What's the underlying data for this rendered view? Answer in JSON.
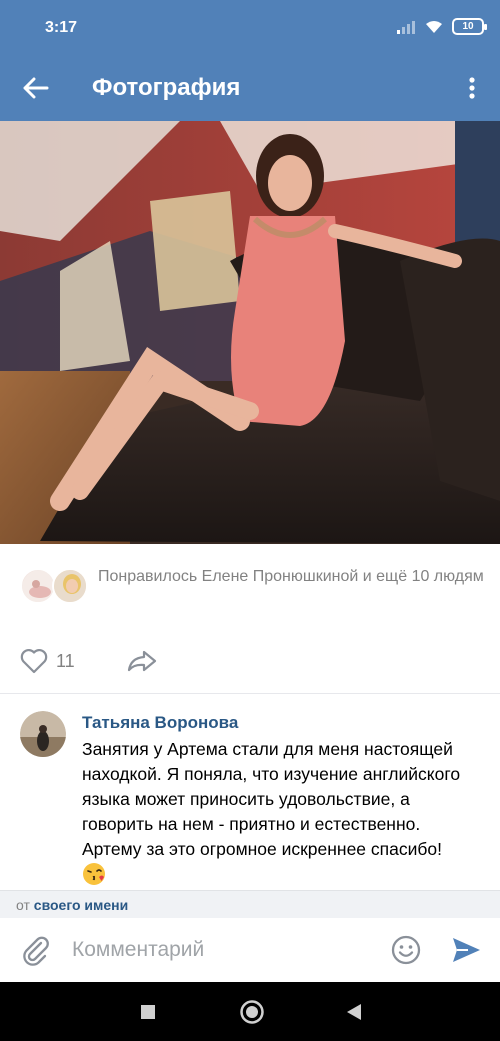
{
  "status_bar": {
    "time": "3:17",
    "battery": "10"
  },
  "app_bar": {
    "title": "Фотография"
  },
  "photo": {
    "alt": "photo-woman-in-pink-dress"
  },
  "likes": {
    "summary": "Понравилось Елене Пронюшкиной и ещё 10 людям"
  },
  "actions": {
    "like_count": "11"
  },
  "comment": {
    "author": "Татьяна Воронова",
    "text": "Занятия у Артема стали для меня настоящей находкой. Я поняла, что изучение английского языка может приносить удовольствие, а говорить на нем - приятно и естественно. Артему за это огромное искреннее спасибо!"
  },
  "from_bar": {
    "prefix": "от",
    "link": "своего имени"
  },
  "input": {
    "placeholder": "Комментарий"
  },
  "colors": {
    "brand": "#5181b8",
    "link": "#2a5885",
    "send": "#5181b8"
  }
}
